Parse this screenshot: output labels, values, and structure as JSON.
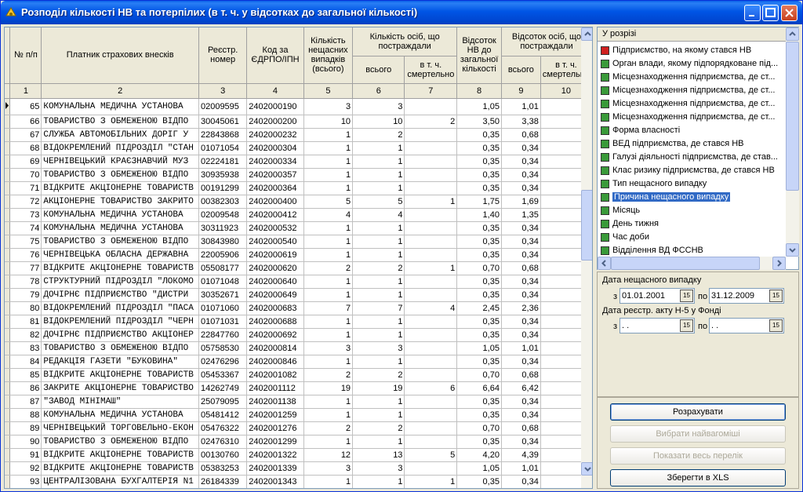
{
  "window": {
    "title": "Розподіл кількості НВ та потерпілих (в т. ч. у відсотках до загальної кількості)"
  },
  "grid": {
    "headers": {
      "c1": "№ п/п",
      "c2": "Платник страхових внесків",
      "c3": "Реєстр. номер",
      "c4": "Код за ЄДРПО/ІПН",
      "c5": "Кількість нещасних випадків (всього)",
      "c67": "Кількість осіб, що постраждали",
      "c6": "всього",
      "c7": "в т. ч. смертельно",
      "c8": "Відсоток НВ до загальної кількості",
      "c910": "Відсоток осіб, що постраждали",
      "c9": "всього",
      "c10": "в т. ч. смертельно"
    },
    "colnums": [
      "1",
      "2",
      "3",
      "4",
      "5",
      "6",
      "7",
      "8",
      "9",
      "10"
    ],
    "rows": [
      [
        "65",
        "КОМУНАЛЬНА МЕДИЧНА УСТАНОВА",
        "02009595",
        "2402000190",
        "3",
        "3",
        "",
        "1,05",
        "1,01"
      ],
      [
        "66",
        "ТОВАРИСТВО З ОБМЕЖЕНОЮ ВІДПО",
        "30045061",
        "2402000200",
        "10",
        "10",
        "2",
        "3,50",
        "3,38"
      ],
      [
        "67",
        "СЛУЖБА АВТОМОБІЛЬНИХ ДОРІГ У",
        "22843868",
        "2402000232",
        "1",
        "2",
        "",
        "0,35",
        "0,68"
      ],
      [
        "68",
        "ВІДОКРЕМЛЕНИЙ ПІДРОЗДІЛ \"СТАН",
        "01071054",
        "2402000304",
        "1",
        "1",
        "",
        "0,35",
        "0,34"
      ],
      [
        "69",
        "ЧЕРНІВЕЦЬКИЙ КРАЄЗНАВЧИЙ МУЗ",
        "02224181",
        "2402000334",
        "1",
        "1",
        "",
        "0,35",
        "0,34"
      ],
      [
        "70",
        "ТОВАРИСТВО З ОБМЕЖЕНОЮ ВІДПО",
        "30935938",
        "2402000357",
        "1",
        "1",
        "",
        "0,35",
        "0,34"
      ],
      [
        "71",
        "ВІДКРИТЕ АКЦІОНЕРНЕ ТОВАРИСТВ",
        "00191299",
        "2402000364",
        "1",
        "1",
        "",
        "0,35",
        "0,34"
      ],
      [
        "72",
        "АКЦІОНЕРНЕ ТОВАРИСТВО ЗАКРИТО",
        "00382303",
        "2402000400",
        "5",
        "5",
        "1",
        "1,75",
        "1,69"
      ],
      [
        "73",
        "КОМУНАЛЬНА МЕДИЧНА УСТАНОВА",
        "02009548",
        "2402000412",
        "4",
        "4",
        "",
        "1,40",
        "1,35"
      ],
      [
        "74",
        "КОМУНАЛЬНА МЕДИЧНА УСТАНОВА",
        "30311923",
        "2402000532",
        "1",
        "1",
        "",
        "0,35",
        "0,34"
      ],
      [
        "75",
        "ТОВАРИСТВО З ОБМЕЖЕНОЮ ВІДПО",
        "30843980",
        "2402000540",
        "1",
        "1",
        "",
        "0,35",
        "0,34"
      ],
      [
        "76",
        "ЧЕРНІВЕЦЬКА ОБЛАСНА ДЕРЖАВНА",
        "22005906",
        "2402000619",
        "1",
        "1",
        "",
        "0,35",
        "0,34"
      ],
      [
        "77",
        "ВІДКРИТЕ АКЦІОНЕРНЕ ТОВАРИСТВ",
        "05508177",
        "2402000620",
        "2",
        "2",
        "1",
        "0,70",
        "0,68"
      ],
      [
        "78",
        "СТРУКТУРНИЙ ПІДРОЗДІЛ \"ЛОКОМО",
        "01071048",
        "2402000640",
        "1",
        "1",
        "",
        "0,35",
        "0,34"
      ],
      [
        "79",
        "ДОЧІРНЄ ПІДПРИЄМСТВО \"ДИСТРИ",
        "30352671",
        "2402000649",
        "1",
        "1",
        "",
        "0,35",
        "0,34"
      ],
      [
        "80",
        "ВІДОКРЕМЛЕНИЙ ПІДРОЗДІЛ \"ПАСА",
        "01071060",
        "2402000683",
        "7",
        "7",
        "4",
        "2,45",
        "2,36"
      ],
      [
        "81",
        "ВІДОКРЕМЛЕНИЙ ПІДРОЗДІЛ \"ЧЕРН",
        "01071031",
        "2402000688",
        "1",
        "1",
        "",
        "0,35",
        "0,34"
      ],
      [
        "82",
        "ДОЧІРНЄ ПІДПРИЄМСТВО АКЦІОНЕР",
        "22847760",
        "2402000692",
        "1",
        "1",
        "",
        "0,35",
        "0,34"
      ],
      [
        "83",
        "ТОВАРИСТВО З ОБМЕЖЕНОЮ ВІДПО",
        "05758530",
        "2402000814",
        "3",
        "3",
        "",
        "1,05",
        "1,01"
      ],
      [
        "84",
        "РЕДАКЦІЯ ГАЗЕТИ \"БУКОВИНА\"",
        "02476296",
        "2402000846",
        "1",
        "1",
        "",
        "0,35",
        "0,34"
      ],
      [
        "85",
        "ВІДКРИТЕ АКЦІОНЕРНЕ ТОВАРИСТВ",
        "05453367",
        "2402001082",
        "2",
        "2",
        "",
        "0,70",
        "0,68"
      ],
      [
        "86",
        "ЗАКРИТЕ АКЦІОНЕРНЕ ТОВАРИСТВО",
        "14262749",
        "2402001112",
        "19",
        "19",
        "6",
        "6,64",
        "6,42"
      ],
      [
        "87",
        "\"ЗАВОД МІНІМАШ\"",
        "25079095",
        "2402001138",
        "1",
        "1",
        "",
        "0,35",
        "0,34"
      ],
      [
        "88",
        "КОМУНАЛЬНА МЕДИЧНА УСТАНОВА",
        "05481412",
        "2402001259",
        "1",
        "1",
        "",
        "0,35",
        "0,34"
      ],
      [
        "89",
        "ЧЕРНІВЕЦЬКИЙ ТОРГОВЕЛЬНО-ЕКОН",
        "05476322",
        "2402001276",
        "2",
        "2",
        "",
        "0,70",
        "0,68"
      ],
      [
        "90",
        "ТОВАРИСТВО З ОБМЕЖЕНОЮ ВІДПО",
        "02476310",
        "2402001299",
        "1",
        "1",
        "",
        "0,35",
        "0,34"
      ],
      [
        "91",
        "ВІДКРИТЕ АКЦІОНЕРНЕ ТОВАРИСТВ",
        "00130760",
        "2402001322",
        "12",
        "13",
        "5",
        "4,20",
        "4,39"
      ],
      [
        "92",
        "ВІДКРИТЕ АКЦІОНЕРНЕ ТОВАРИСТВ",
        "05383253",
        "2402001339",
        "3",
        "3",
        "",
        "1,05",
        "1,01"
      ],
      [
        "93",
        "ЦЕНТРАЛІЗОВАНА БУХГАЛТЕРІЯ  N1",
        "26184339",
        "2402001343",
        "1",
        "1",
        "1",
        "0,35",
        "0,34"
      ]
    ]
  },
  "breakdown": {
    "header": "У розрізі",
    "items": [
      {
        "label": "Підприємство, на якому стався НВ",
        "icon": "red"
      },
      {
        "label": "Орган влади, якому підпорядковане під...",
        "icon": "green"
      },
      {
        "label": "Місцезнаходження підприємства, де ст...",
        "icon": "green"
      },
      {
        "label": "Місцезнаходження підприємства, де ст...",
        "icon": "green"
      },
      {
        "label": "Місцезнаходження підприємства, де ст...",
        "icon": "green"
      },
      {
        "label": "Місцезнаходження підприємства, де ст...",
        "icon": "green"
      },
      {
        "label": "Форма власності",
        "icon": "green"
      },
      {
        "label": "ВЕД підприємства, де стався НВ",
        "icon": "green"
      },
      {
        "label": "Галузі діяльності підприємства, де став...",
        "icon": "green"
      },
      {
        "label": "Клас ризику підприємства, де стався НВ",
        "icon": "green"
      },
      {
        "label": "Тип нещасного випадку",
        "icon": "green"
      },
      {
        "label": "Причина нещасного випадку",
        "icon": "green",
        "selected": true
      },
      {
        "label": "Місяць",
        "icon": "green"
      },
      {
        "label": "День тижня",
        "icon": "green"
      },
      {
        "label": "Час доби",
        "icon": "green"
      },
      {
        "label": "Відділення ВД ФССНВ",
        "icon": "green"
      }
    ]
  },
  "filters": {
    "accident_date_label": "Дата нещасного випадку",
    "from": "з",
    "to": "по",
    "accident_from": "01.01.2001",
    "accident_to": "31.12.2009",
    "registry_label": "Дата реєстр. акту Н-5 у Фонді",
    "registry_from": " .  .",
    "registry_to": " .  ."
  },
  "buttons": {
    "calculate": "Розрахувати",
    "select_main": "Вибрати найвагоміші",
    "show_all": "Показати весь перелік",
    "save_xls": "Зберегти в XLS"
  }
}
